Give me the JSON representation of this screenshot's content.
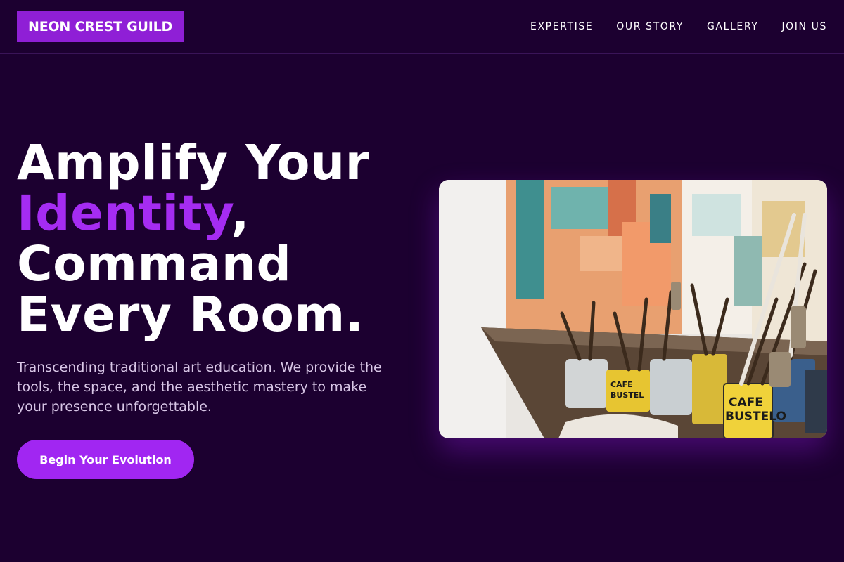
{
  "nav": {
    "logo": "NEON CREST GUILD",
    "links": [
      "EXPERTISE",
      "OUR STORY",
      "GALLERY",
      "JOIN US"
    ]
  },
  "hero": {
    "headline_line1": "Amplify Your",
    "headline_accent": "Identity",
    "headline_comma": ",",
    "headline_line3": "Command",
    "headline_line4": "Every Room.",
    "subtext": "Transcending traditional art education. We provide the tools, the space, and the aesthetic mastery to make your presence unforgettable.",
    "cta_label": "Begin Your Evolution"
  },
  "photo": {
    "can_label_1": "CAFE",
    "can_label_2": "BUSTELO",
    "can_label_3": "CAFE",
    "can_label_4": "BUSTEL"
  },
  "colors": {
    "background": "#1c0030",
    "accent": "#a52cf2",
    "logo_bg": "#8f1fd6",
    "cta_bg": "#a126f2",
    "subtext": "#d8c6e6"
  }
}
